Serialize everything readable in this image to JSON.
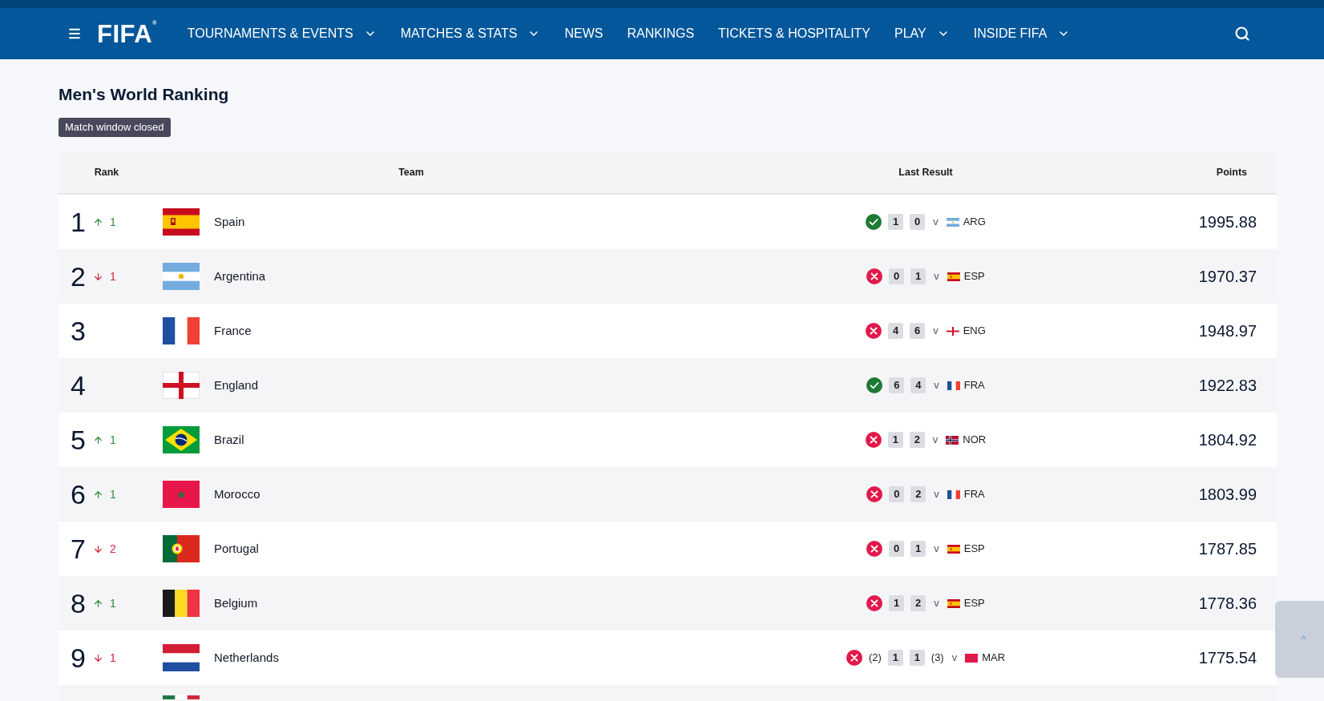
{
  "nav": {
    "logo": "FIFA$^{®}$",
    "items": [
      {
        "label": "TOURNAMENTS & EVENTS",
        "has_menu": true
      },
      {
        "label": "MATCHES & STATS",
        "has_menu": true
      },
      {
        "label": "NEWS",
        "has_menu": false
      },
      {
        "label": "RANKINGS",
        "has_menu": false
      },
      {
        "label": "TICKETS & HOSPITALITY",
        "has_menu": false
      },
      {
        "label": "PLAY",
        "has_menu": true
      },
      {
        "label": "INSIDE FIFA",
        "has_menu": true
      }
    ]
  },
  "page": {
    "title": "Men's World Ranking",
    "badge": "Match window closed"
  },
  "table": {
    "columns": [
      "Rank",
      "Team",
      "Last Result",
      "Points"
    ],
    "rows": [
      {
        "rank": "1",
        "change": {
          "kind": "up",
          "value": "1"
        },
        "flag": {
          "kind": "es"
        },
        "team": "Spain",
        "result": {
          "won": true,
          "score_for": "1",
          "score_against": "0",
          "versus": "v",
          "opponent_flag": {
            "kind": "ar"
          },
          "opponent": "ARG"
        },
        "points": "1995.88"
      },
      {
        "rank": "2",
        "change": {
          "kind": "down",
          "value": "1"
        },
        "flag": {
          "kind": "ar"
        },
        "team": "Argentina",
        "result": {
          "won": false,
          "score_for": "0",
          "score_against": "1",
          "versus": "v",
          "opponent_flag": {
            "kind": "es"
          },
          "opponent": "ESP"
        },
        "points": "1970.37"
      },
      {
        "rank": "3",
        "flag": {
          "kind": "fr"
        },
        "team": "France",
        "result": {
          "won": false,
          "score_for": "4",
          "score_against": "6",
          "versus": "v",
          "opponent_flag": {
            "kind": "eng"
          },
          "opponent": "ENG"
        },
        "points": "1948.97"
      },
      {
        "rank": "4",
        "flag": {
          "kind": "eng"
        },
        "team": "England",
        "result": {
          "won": true,
          "score_for": "6",
          "score_against": "4",
          "versus": "v",
          "opponent_flag": {
            "kind": "fr"
          },
          "opponent": "FRA"
        },
        "points": "1922.83"
      },
      {
        "rank": "5",
        "change": {
          "kind": "up",
          "value": "1"
        },
        "flag": {
          "kind": "br"
        },
        "team": "Brazil",
        "result": {
          "won": false,
          "score_for": "1",
          "score_against": "2",
          "versus": "v",
          "opponent_flag": {
            "kind": "no"
          },
          "opponent": "NOR"
        },
        "points": "1804.92"
      },
      {
        "rank": "6",
        "change": {
          "kind": "up",
          "value": "1"
        },
        "flag": {
          "kind": "ma"
        },
        "team": "Morocco",
        "result": {
          "won": false,
          "score_for": "0",
          "score_against": "2",
          "versus": "v",
          "opponent_flag": {
            "kind": "fr"
          },
          "opponent": "FRA"
        },
        "points": "1803.99"
      },
      {
        "rank": "7",
        "change": {
          "kind": "down",
          "value": "2"
        },
        "flag": {
          "kind": "pt"
        },
        "team": "Portugal",
        "result": {
          "won": false,
          "score_for": "0",
          "score_against": "1",
          "versus": "v",
          "opponent_flag": {
            "kind": "es"
          },
          "opponent": "ESP"
        },
        "points": "1787.85"
      },
      {
        "rank": "8",
        "change": {
          "kind": "up",
          "value": "1"
        },
        "flag": {
          "kind": "be"
        },
        "team": "Belgium",
        "result": {
          "won": false,
          "score_for": "1",
          "score_against": "2",
          "versus": "v",
          "opponent_flag": {
            "kind": "es"
          },
          "opponent": "ESP"
        },
        "points": "1778.36"
      },
      {
        "rank": "9",
        "change": {
          "kind": "down",
          "value": "1"
        },
        "flag": {
          "kind": "nl"
        },
        "team": "Netherlands",
        "result": {
          "won": false,
          "penalty_for": "(2)",
          "score_for": "1",
          "score_against": "1",
          "penalty_against": "(3)",
          "versus": "v",
          "opponent_flag": {
            "kind": "ma"
          },
          "opponent": "MAR"
        },
        "points": "1775.54"
      }
    ],
    "partial_row": {
      "flag": {
        "kind": "it"
      }
    }
  },
  "scroll_top": {
    "label": "^"
  }
}
